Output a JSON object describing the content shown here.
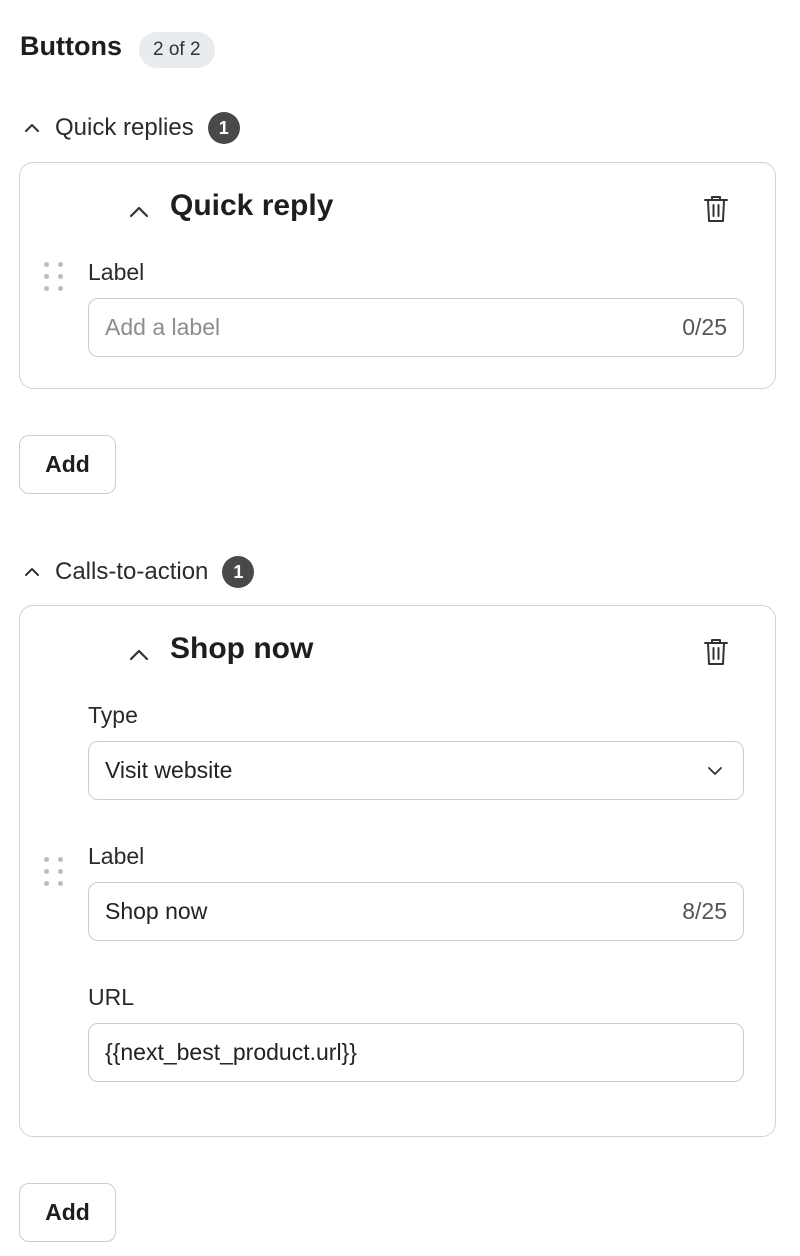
{
  "header": {
    "title": "Buttons",
    "count_badge": "2 of 2"
  },
  "quick_replies": {
    "section_label": "Quick replies",
    "count": "1",
    "card": {
      "title": "Quick reply",
      "label_field": {
        "label": "Label",
        "placeholder": "Add a label",
        "value": "",
        "counter": "0/25"
      }
    },
    "add_label": "Add"
  },
  "ctas": {
    "section_label": "Calls-to-action",
    "count": "1",
    "card": {
      "title": "Shop now",
      "type_field": {
        "label": "Type",
        "value": "Visit website"
      },
      "label_field": {
        "label": "Label",
        "value": "Shop now",
        "counter": "8/25"
      },
      "url_field": {
        "label": "URL",
        "value": "{{next_best_product.url}}"
      }
    },
    "add_label": "Add"
  },
  "icons": {
    "section_toggle": "chevron-up-icon",
    "card_collapse": "chevron-up-icon",
    "delete": "trash-icon",
    "drag": "drag-handle-icon",
    "select_caret": "chevron-down-icon"
  },
  "colors": {
    "badge_bg": "#e8ebef",
    "count_dot": "#494949",
    "border": "#cfd3d8"
  }
}
